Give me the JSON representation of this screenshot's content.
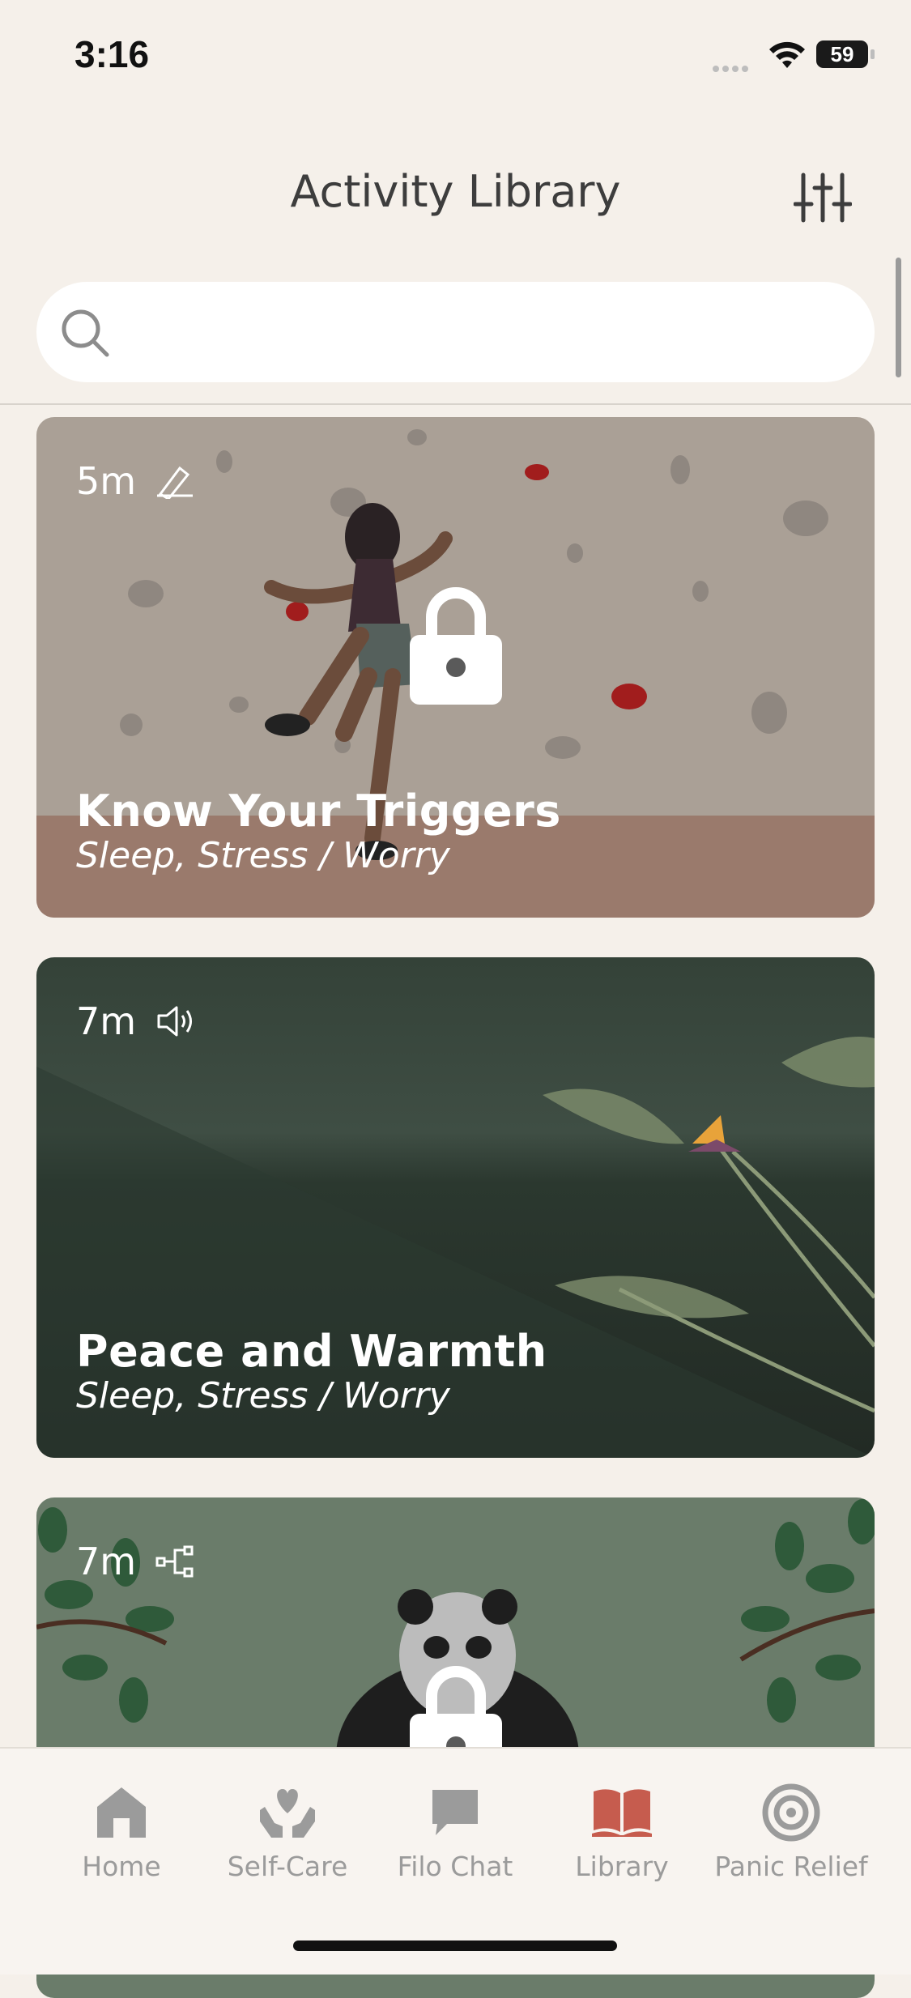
{
  "status_bar": {
    "time": "3:16",
    "battery": "59"
  },
  "header": {
    "title": "Activity Library",
    "filter_icon": "sliders-icon"
  },
  "search": {
    "placeholder": "",
    "icon": "search-icon"
  },
  "cards": [
    {
      "duration": "5m",
      "type_icon": "pencil-icon",
      "title": "Know Your Triggers",
      "tags": "Sleep, Stress / Worry",
      "locked": true
    },
    {
      "duration": "7m",
      "type_icon": "speaker-icon",
      "title": "Peace and Warmth",
      "tags": "Sleep, Stress / Worry",
      "locked": false
    },
    {
      "duration": "7m",
      "type_icon": "flowchart-icon",
      "title": "",
      "tags": "",
      "locked": true
    }
  ],
  "tab_bar": {
    "items": [
      {
        "label": "Home",
        "icon": "home-icon",
        "active": false
      },
      {
        "label": "Self-Care",
        "icon": "heart-hands-icon",
        "active": false
      },
      {
        "label": "Filo Chat",
        "icon": "chat-bubble-icon",
        "active": false
      },
      {
        "label": "Library",
        "icon": "book-icon",
        "active": true
      },
      {
        "label": "Panic Relief",
        "icon": "target-icon",
        "active": false
      }
    ]
  },
  "colors": {
    "accent": "#c65c4e",
    "inactive": "#9b9b9b",
    "background": "#f5f0ea"
  }
}
